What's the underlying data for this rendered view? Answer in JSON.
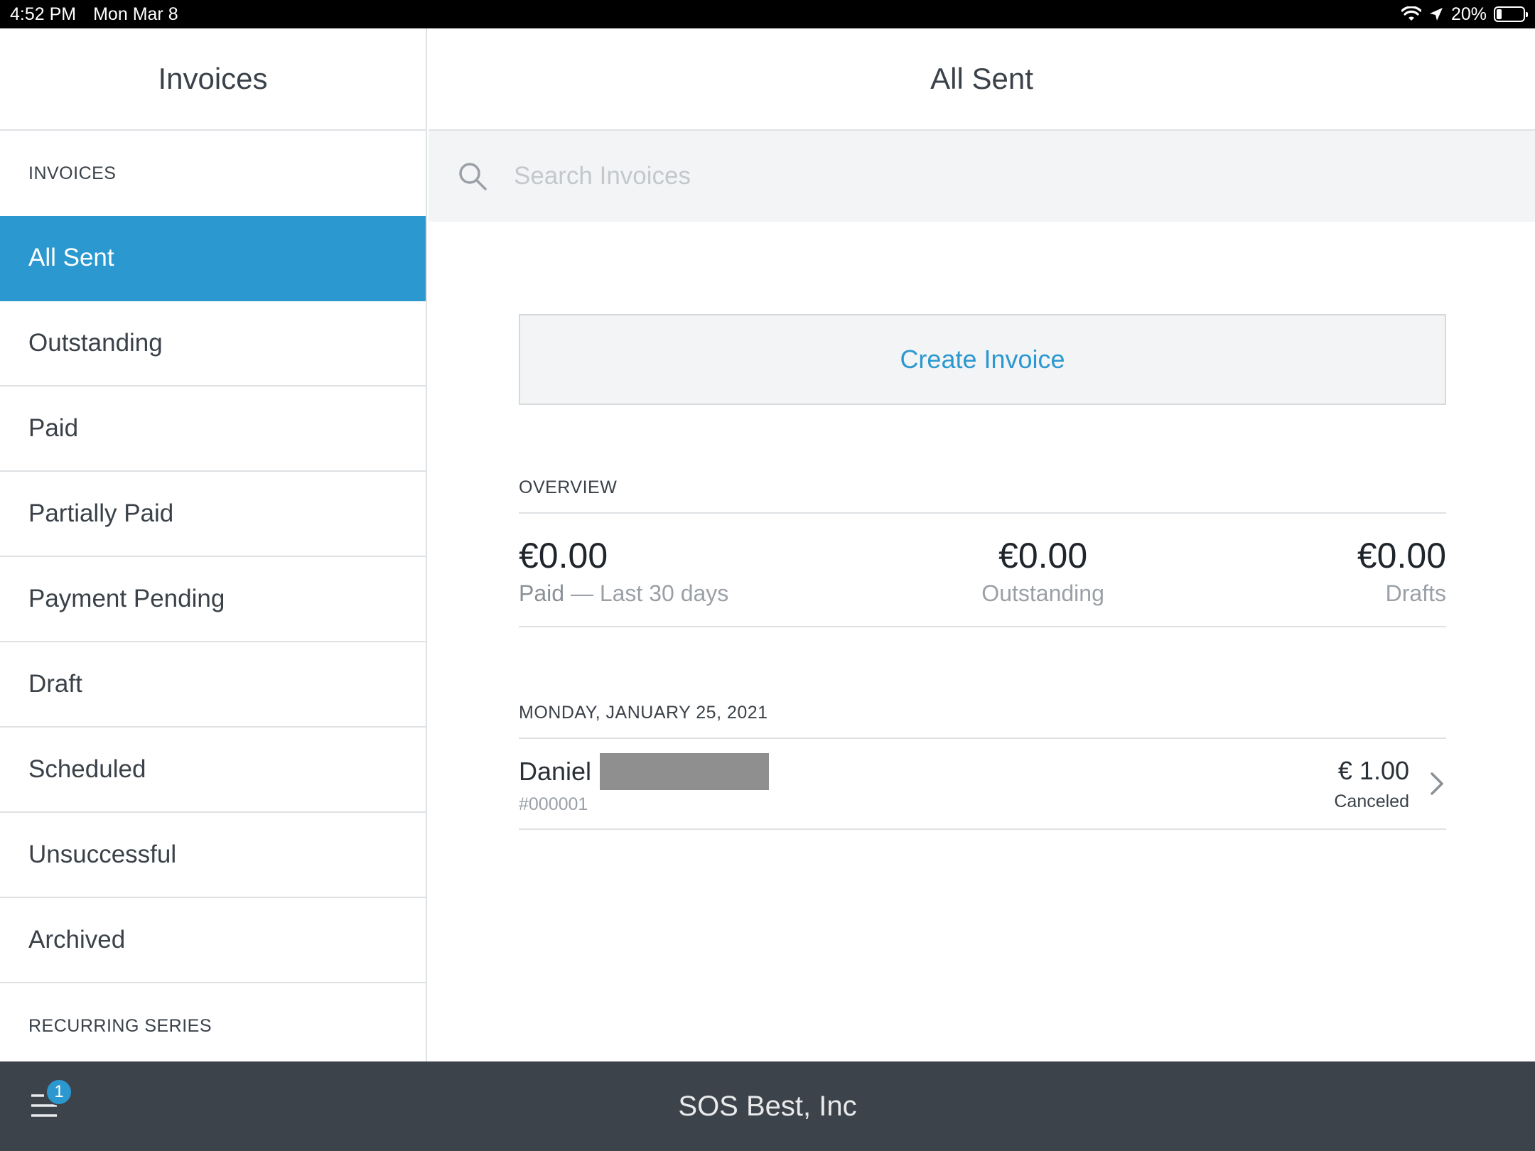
{
  "status_bar": {
    "time": "4:52 PM",
    "date": "Mon Mar 8",
    "battery": "20%"
  },
  "sidebar": {
    "title": "Invoices",
    "section_label": "INVOICES",
    "items": [
      {
        "label": "All Sent"
      },
      {
        "label": "Outstanding"
      },
      {
        "label": "Paid"
      },
      {
        "label": "Partially Paid"
      },
      {
        "label": "Payment Pending"
      },
      {
        "label": "Draft"
      },
      {
        "label": "Scheduled"
      },
      {
        "label": "Unsuccessful"
      },
      {
        "label": "Archived"
      }
    ],
    "recurring_label": "RECURRING SERIES"
  },
  "main": {
    "title": "All Sent",
    "search": {
      "placeholder": "Search Invoices"
    },
    "create_button": "Create Invoice",
    "overview": {
      "label": "OVERVIEW",
      "paid": {
        "amount": "€0.00",
        "label": "Paid",
        "suffix": " — Last 30 days"
      },
      "outstanding": {
        "amount": "€0.00",
        "label": "Outstanding"
      },
      "drafts": {
        "amount": "€0.00",
        "label": "Drafts"
      }
    },
    "groups": [
      {
        "date": "MONDAY, JANUARY 25, 2021",
        "invoices": [
          {
            "name": "Daniel",
            "number": "#000001",
            "amount": "€ 1.00",
            "status": "Canceled"
          }
        ]
      }
    ]
  },
  "bottom_bar": {
    "business_name": "SOS Best, Inc",
    "badge_count": "1"
  },
  "colors": {
    "accent": "#2b98d0",
    "bottom_bar": "#3d434a"
  },
  "icons": [
    "wifi-icon",
    "location-icon",
    "battery-icon",
    "search-icon",
    "chevron-right-icon",
    "menu-icon"
  ]
}
